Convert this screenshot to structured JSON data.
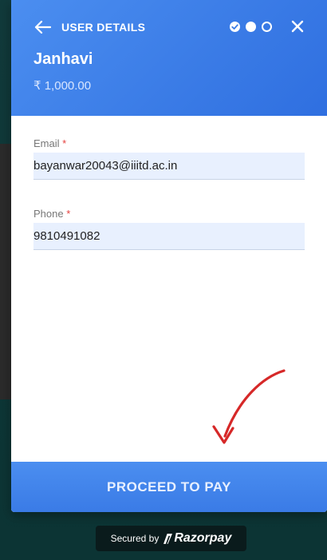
{
  "header": {
    "title": "USER DETAILS",
    "name": "Janhavi",
    "amount": "₹ 1,000.00",
    "steps": [
      "done",
      "active",
      "pending"
    ]
  },
  "form": {
    "email": {
      "label": "Email",
      "required_mark": "*",
      "value": "bayanwar20043@iiitd.ac.in"
    },
    "phone": {
      "label": "Phone",
      "required_mark": "*",
      "value": "9810491082"
    }
  },
  "footer": {
    "pay_label": "PROCEED TO PAY",
    "secured_by": "Secured by",
    "brand": "Razorpay"
  },
  "colors": {
    "accent": "#3a7be6",
    "required": "#e5413f",
    "annotation_arrow": "#d62828"
  },
  "icons": {
    "back": "arrow-left-icon",
    "close": "close-icon",
    "step_done": "check-circle-icon",
    "brand": "razorpay-logo-icon"
  }
}
